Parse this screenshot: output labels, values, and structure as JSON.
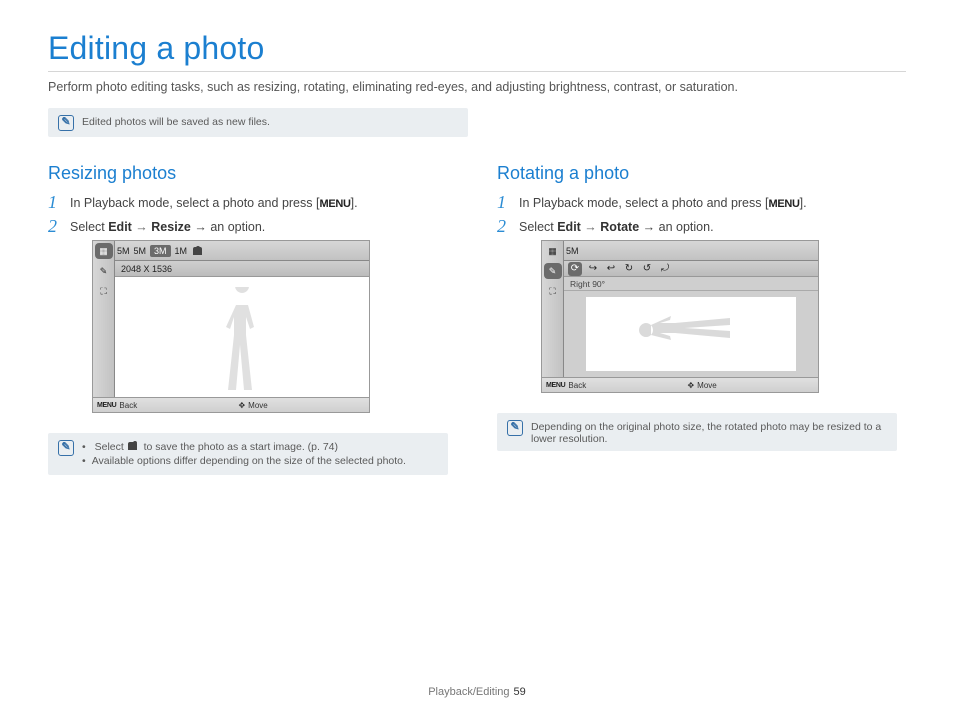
{
  "page": {
    "title": "Editing a photo",
    "intro": "Perform photo editing tasks, such as resizing, rotating, eliminating red-eyes, and adjusting brightness, contrast, or saturation.",
    "topNote": "Edited photos will be saved as new files.",
    "footerSection": "Playback/Editing",
    "footerPage": "59"
  },
  "left": {
    "heading": "Resizing photos",
    "step1_pre": "In Playback mode, select a photo and press [",
    "step1_menu": "MENU",
    "step1_post": "].",
    "step2_pre": "Select ",
    "step2_b1": "Edit",
    "step2_arrow": " → ",
    "step2_b2": "Resize",
    "step2_post": " → an option.",
    "screenshot": {
      "topOptions": [
        "5M",
        "5M",
        "3M",
        "1M"
      ],
      "topSelectedIndex": 2,
      "subLabel": "2048 X 1536",
      "sideIcons": [
        "▦",
        "✎",
        "⛶"
      ],
      "footerMenu": "MENU",
      "footerBack": "Back",
      "footerMove": "Move"
    },
    "note": {
      "line1_pre": "Select ",
      "line1_post": " to save the photo as a start image. (p. 74)",
      "line2": "Available options differ depending on the size of the selected photo."
    }
  },
  "right": {
    "heading": "Rotating a photo",
    "step1_pre": "In Playback mode, select a photo and press [",
    "step1_menu": "MENU",
    "step1_post": "].",
    "step2_pre": "Select ",
    "step2_b1": "Edit",
    "step2_arrow": " → ",
    "step2_b2": "Rotate",
    "step2_post": " → an option.",
    "screenshot": {
      "topLabel": "5M",
      "subLabel": "Right 90°",
      "rotateIcons": [
        "⟳",
        "↪",
        "↩",
        "↻",
        "↺",
        "⤾"
      ],
      "rotateSelectedIndex": 0,
      "sideIcons": [
        "▦",
        "✎",
        "⛶"
      ],
      "footerMenu": "MENU",
      "footerBack": "Back",
      "footerMove": "Move"
    },
    "note": "Depending on the original photo size, the rotated photo may be resized to a lower resolution."
  }
}
